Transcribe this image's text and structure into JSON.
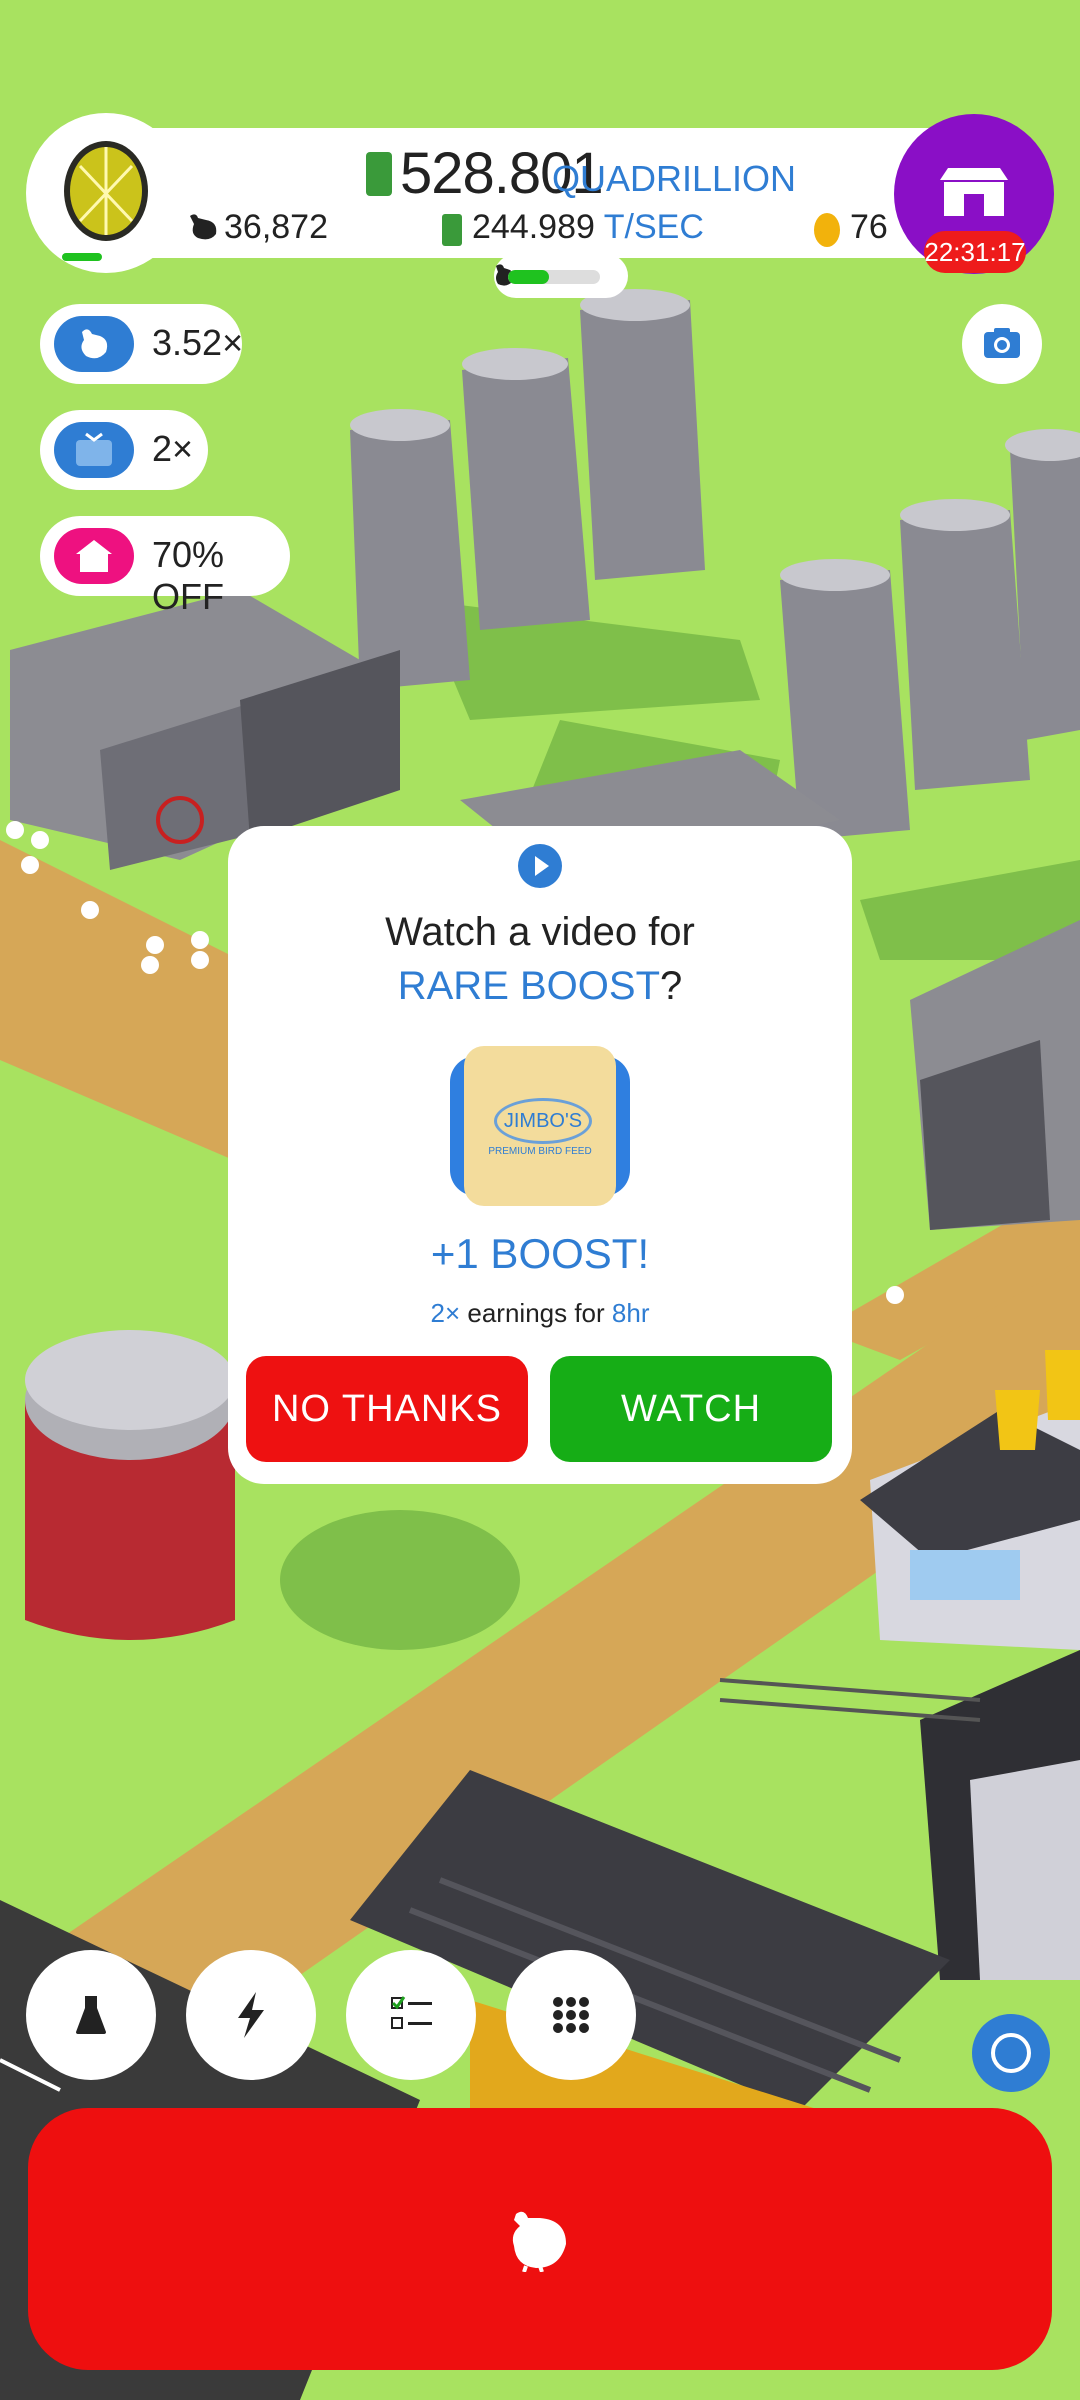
{
  "header": {
    "money": "528.801",
    "money_unit": "QUADRILLION",
    "chicken_count": "36,872",
    "rate_value": "244.989",
    "rate_unit": "T/SEC",
    "golden_eggs": "76",
    "shop_timer": "22:31:17",
    "progress_fraction": 0.45
  },
  "boosts": [
    {
      "icon": "chicken-boost-icon",
      "label": "3.52×"
    },
    {
      "icon": "tv-boost-icon",
      "label": "2×"
    },
    {
      "icon": "house-discount-icon",
      "label": "70% OFF"
    }
  ],
  "dialog": {
    "title": "Watch a video for",
    "subtitle": "RARE BOOST",
    "subtitle_suffix": "?",
    "bag_brand": "JIMBO'S",
    "bag_tagline": "PREMIUM BIRD FEED",
    "reward": "+1 BOOST!",
    "earnings_multiplier": "2×",
    "earnings_text": "earnings for",
    "earnings_duration": "8hr",
    "no_thanks_label": "NO THANKS",
    "watch_label": "WATCH"
  },
  "bottom_nav": [
    "flask-icon",
    "lightning-icon",
    "checklist-icon",
    "grid-icon"
  ],
  "colors": {
    "grass": "#a8e260",
    "accent_blue": "#2f7dd3",
    "red": "#ee1111",
    "green": "#16ad16",
    "purple": "#8a0fc6"
  }
}
